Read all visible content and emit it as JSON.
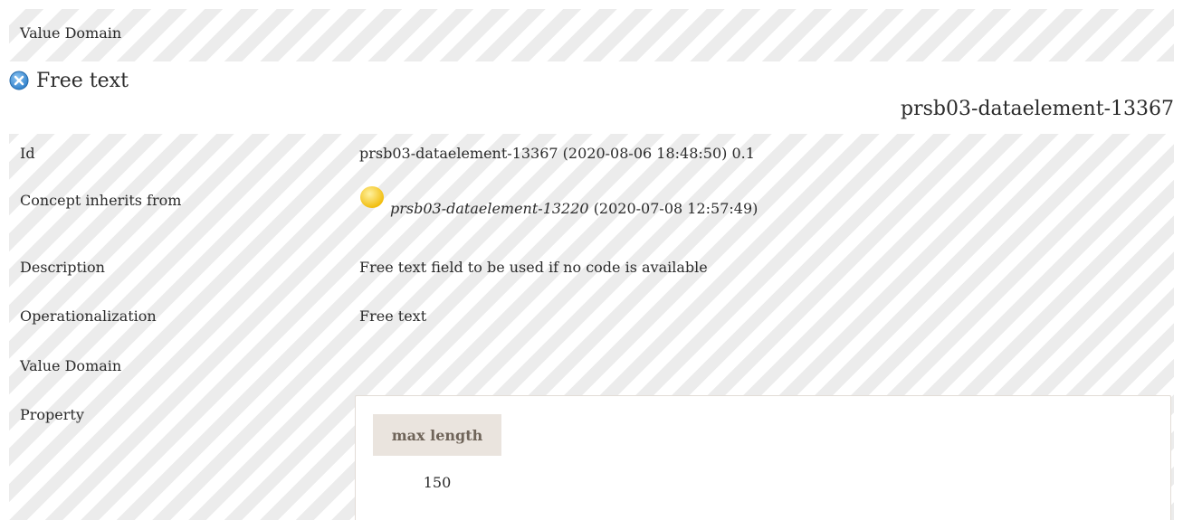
{
  "header": {
    "label": "Value Domain"
  },
  "title": {
    "text": "Free text",
    "icon": "close-icon"
  },
  "concept_id": "prsb03-dataelement-13367",
  "details": {
    "id_label": "Id",
    "id_value": "prsb03-dataelement-13367 (2020-08-06 18:48:50) 0.1",
    "inherits_label": "Concept inherits from",
    "inherits_link": "prsb03-dataelement-13220",
    "inherits_date": "(2020-07-08 12:57:49)",
    "description_label": "Description",
    "description_value": "Free text field to be used if no code is available",
    "operationalization_label": "Operationalization",
    "operationalization_value": "Free text",
    "value_domain_label": "Value Domain",
    "property_label": "Property"
  },
  "property_table": {
    "header": "max length",
    "value": "150"
  },
  "colors": {
    "stripe": "#ececec",
    "close_icon": "#3d8fd6",
    "status_dot": "#f5c400",
    "table_header_bg": "#eae4de",
    "table_header_text": "#6f6459"
  }
}
